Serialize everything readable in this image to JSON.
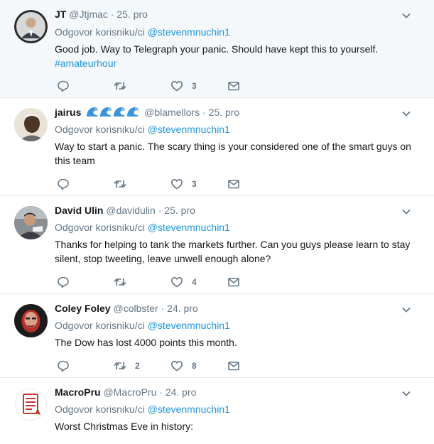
{
  "reply_prefix": "Odgovor korisniku/ci",
  "reply_target": "@stevenmnuchin1",
  "tweets": [
    {
      "name": "JT",
      "handle": "@Jtjmac",
      "dot": "·",
      "date": "25. pro",
      "text": "Good job.   Way to Telegraph your panic.  Should have kept this to yourself.",
      "hashtag": "#amateurhour",
      "reply_count": "",
      "retweet_count": "",
      "like_count": "3"
    },
    {
      "name": "jairus",
      "handle": "@blamellors",
      "dot": "·",
      "date": "25. pro",
      "text": "Way to start a panic. The scary thing is your considered one of the smart guys on this team",
      "reply_count": "",
      "retweet_count": "",
      "like_count": "3"
    },
    {
      "name": "David Ulin",
      "handle": "@davidulin",
      "dot": "·",
      "date": "25. pro",
      "text": "Thanks for helping to tank the markets further. Can you guys please learn to stay silent, stop tweeting, leave unwell enough alone?",
      "reply_count": "",
      "retweet_count": "",
      "like_count": "4"
    },
    {
      "name": "Coley Foley",
      "handle": "@colbster",
      "dot": "·",
      "date": "24. pro",
      "text": "The Dow has lost 4000 points this month.",
      "reply_count": "",
      "retweet_count": "2",
      "like_count": "8"
    },
    {
      "name": "MacroPru",
      "handle": "@MacroPru",
      "dot": "·",
      "date": "24. pro",
      "text": "Worst Christmas Eve in history:"
    }
  ],
  "icons": {
    "reply": "reply-icon",
    "retweet": "retweet-icon",
    "like": "heart-icon",
    "dm": "envelope-icon",
    "caret": "chevron-down-icon",
    "wave": "water-wave-emoji"
  },
  "colors": {
    "link": "#1b95e0",
    "muted": "#657786",
    "highlight_bg": "#f5f8fa",
    "border": "#e6ecf0"
  }
}
